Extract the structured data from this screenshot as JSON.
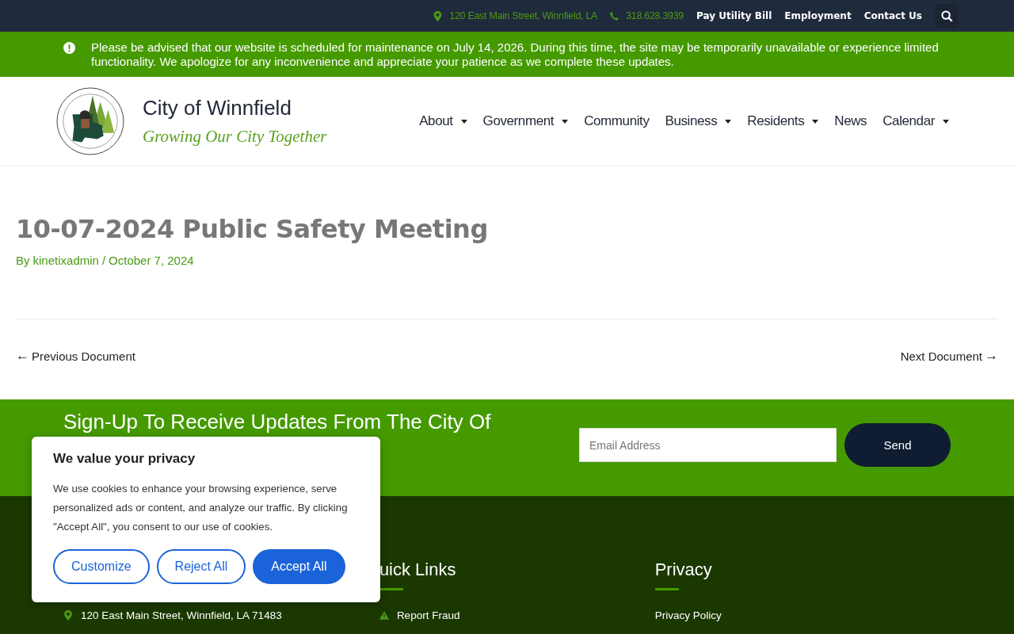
{
  "top_bar": {
    "address": "120 East Main Street, Winnfield, LA",
    "phone": "318.628.3939",
    "links": [
      "Pay Utility Bill",
      "Employment",
      "Contact Us"
    ]
  },
  "notice": {
    "text": "Please be advised that our website is scheduled for maintenance on July 14, 2026. During this time, the site may be temporarily unavailable or experience limited functionality. We apologize for any inconvenience and appreciate your patience as we complete these updates."
  },
  "header": {
    "site_title": "City of Winnfield",
    "tagline": "Growing Our City Together",
    "nav": [
      {
        "label": "About",
        "has_dropdown": true
      },
      {
        "label": "Government",
        "has_dropdown": true
      },
      {
        "label": "Community",
        "has_dropdown": false
      },
      {
        "label": "Business",
        "has_dropdown": true
      },
      {
        "label": "Residents",
        "has_dropdown": true
      },
      {
        "label": "News",
        "has_dropdown": false
      },
      {
        "label": "Calendar",
        "has_dropdown": true
      }
    ]
  },
  "article": {
    "title": "10-07-2024 Public Safety Meeting",
    "by": "By",
    "author": "kinetixadmin",
    "separator": "/",
    "date": "October 7, 2024"
  },
  "post_nav": {
    "previous_arrow": "←",
    "previous": "Previous Document",
    "next": "Next Document",
    "next_arrow": "→"
  },
  "signup": {
    "heading": "Sign-Up To Receive Updates From The City Of",
    "placeholder": "Email Address",
    "button": "Send"
  },
  "footer": {
    "columns": [
      {
        "items": [
          {
            "kind": "pin",
            "text": "120 East Main Street, Winnfield, LA 71483"
          }
        ]
      },
      {
        "heading": "uick Links",
        "items": [
          {
            "kind": "warning",
            "text": "Report Fraud"
          }
        ]
      },
      {
        "heading": "Privacy",
        "items": [
          {
            "kind": "plain",
            "text": "Privacy Policy"
          }
        ]
      }
    ]
  },
  "cookie": {
    "title": "We value your privacy",
    "text": "We use cookies to enhance your browsing experience, serve personalized ads or content, and analyze our traffic. By clicking \"Accept All\", you consent to our use of cookies.",
    "buttons": [
      {
        "label": "Customize",
        "primary": false
      },
      {
        "label": "Reject All",
        "primary": false
      },
      {
        "label": "Accept All",
        "primary": true
      }
    ]
  }
}
